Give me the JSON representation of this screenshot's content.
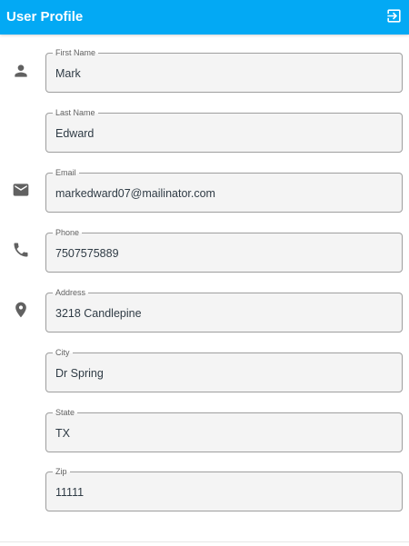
{
  "header": {
    "title": "User Profile",
    "logout_icon": "logout-icon",
    "background_color": "#03A9F4"
  },
  "icons": {
    "name": "person-icon",
    "email": "email-icon",
    "phone": "phone-icon",
    "address": "location-pin-icon"
  },
  "form": {
    "first_name": {
      "label": "First Name",
      "value": "Mark"
    },
    "last_name": {
      "label": "Last Name",
      "value": "Edward"
    },
    "email": {
      "label": "Email",
      "value": "markedward07@mailinator.com"
    },
    "phone": {
      "label": "Phone",
      "value": "7507575889"
    },
    "address": {
      "label": "Address",
      "value": "3218 Candlepine"
    },
    "city": {
      "label": "City",
      "value": "Dr Spring"
    },
    "state": {
      "label": "State",
      "value": "TX"
    },
    "zip": {
      "label": "Zip",
      "value": "11111"
    }
  }
}
